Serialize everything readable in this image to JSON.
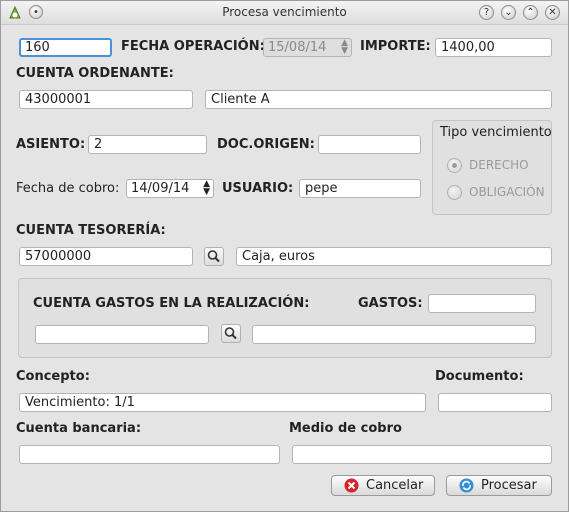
{
  "window": {
    "title": "Procesa vencimiento"
  },
  "form": {
    "numero": "160",
    "fecha_operacion_label": "FECHA OPERACIÓN:",
    "fecha_operacion": "15/08/14",
    "importe_label": "IMPORTE:",
    "importe": "1400,00",
    "cuenta_ordenante_label": "CUENTA ORDENANTE:",
    "cuenta_ordenante": "43000001",
    "cuenta_ordenante_nombre": "Cliente A",
    "asiento_label": "ASIENTO:",
    "asiento": "2",
    "doc_origen_label": "DOC.ORIGEN:",
    "doc_origen": "",
    "fecha_cobro_label": "Fecha de cobro:",
    "fecha_cobro": "14/09/14",
    "usuario_label": "USUARIO:",
    "usuario": "pepe",
    "cuenta_tesoreria_label": "CUENTA TESORERÍA:",
    "cuenta_tesoreria": "57000000",
    "cuenta_tesoreria_nombre": "Caja, euros",
    "gastos_group_label": "CUENTA GASTOS EN LA REALIZACIÓN:",
    "gastos_label": "GASTOS:",
    "gastos": "",
    "cuenta_gastos": "",
    "cuenta_gastos_nombre": "",
    "concepto_label": "Concepto:",
    "concepto": "Vencimiento:  1/1",
    "documento_label": "Documento:",
    "documento": "",
    "cuenta_bancaria_label": "Cuenta bancaria:",
    "cuenta_bancaria": "",
    "medio_cobro_label": "Medio de cobro",
    "medio_cobro": ""
  },
  "tipo_vencimiento": {
    "title": "Tipo vencimiento",
    "options": [
      "DERECHO",
      "OBLIGACIÓN"
    ],
    "selected": "DERECHO"
  },
  "buttons": {
    "cancel_label": "Cancelar",
    "process_label": "Procesar"
  }
}
